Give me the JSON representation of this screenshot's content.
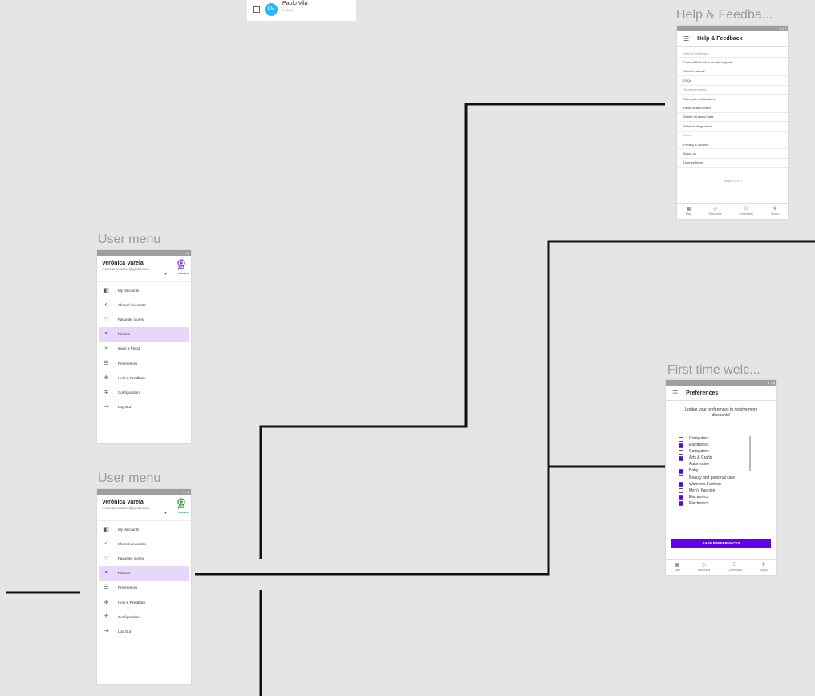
{
  "top_snippet": {
    "avatar_initials": "PM",
    "name": "Pablo Vila",
    "subtitle": "1 friend"
  },
  "frames": {
    "help_feedback_title": "Help & Feedba...",
    "user_menu_title_1": "User menu",
    "user_menu_title_2": "User menu",
    "preferences_title": "First time welc..."
  },
  "user_menu_1": {
    "status": "▾ ◂ ▮",
    "name": "Verónica Varela",
    "email": "v.varelamontalvo@gmail.com",
    "badge_label": "BRONZE",
    "badge_color": "#7b3fe4",
    "items": [
      {
        "label": "My discounts",
        "icon": "dashboard-icon"
      },
      {
        "label": "Shared discounts",
        "icon": "share-icon"
      },
      {
        "label": "Favorites stores",
        "icon": "heart-icon"
      },
      {
        "label": "Friends",
        "icon": "friends-icon"
      },
      {
        "label": "Invite a friend",
        "icon": "send-icon"
      },
      {
        "label": "Preferences",
        "icon": "list-icon"
      },
      {
        "label": "Help & Feedback",
        "icon": "help-icon"
      },
      {
        "label": "Configuration",
        "icon": "gear-icon"
      },
      {
        "label": "Log Out",
        "icon": "logout-icon"
      }
    ]
  },
  "user_menu_2": {
    "status": "▾ ◂ ▮",
    "name": "Verónica Varela",
    "email": "v.varelamontalvo@gmail.com",
    "badge_label": "BRONZE",
    "badge_color": "#2e9e3e",
    "items": [
      {
        "label": "My discounts",
        "icon": "dashboard-icon"
      },
      {
        "label": "Shared discounts",
        "icon": "share-icon"
      },
      {
        "label": "Favorites stores",
        "icon": "heart-icon"
      },
      {
        "label": "Friends",
        "icon": "friends-icon"
      },
      {
        "label": "Preferences",
        "icon": "list-icon"
      },
      {
        "label": "Help & Feedback",
        "icon": "help-icon"
      },
      {
        "label": "Configuration",
        "icon": "gear-icon"
      },
      {
        "label": "Log Out",
        "icon": "logout-icon"
      }
    ]
  },
  "help_feedback": {
    "status": "▾ ◂ ▮",
    "title": "Help & Feedback",
    "rows": [
      {
        "label": "Help & Feedback",
        "section": true
      },
      {
        "label": "Contact BizkaiaUn mobile support",
        "section": false
      },
      {
        "label": "Send feedback",
        "section": false
      },
      {
        "label": "FAQs",
        "section": false
      },
      {
        "label": "Troubleshooting",
        "section": true
      },
      {
        "label": "Test push notifications",
        "section": false
      },
      {
        "label": "Reset search index",
        "section": false
      },
      {
        "label": "Delete all saved data",
        "section": false
      },
      {
        "label": "Network diagnostics",
        "section": false
      },
      {
        "label": "About",
        "section": true
      },
      {
        "label": "Privacy & cookies",
        "section": false
      },
      {
        "label": "About us",
        "section": false
      },
      {
        "label": "License terms",
        "section": false
      }
    ],
    "version": "Version 1.0.0",
    "nav": [
      {
        "label": "Map",
        "icon": "map-icon"
      },
      {
        "label": "Discounts",
        "icon": "tag-icon"
      },
      {
        "label": "Community",
        "icon": "community-icon"
      },
      {
        "label": "Shops",
        "icon": "pin-icon"
      }
    ]
  },
  "preferences": {
    "status": "▾ ◂ ▮",
    "title": "Preferences",
    "prompt": "Update your preferences to receive more discounts!",
    "items": [
      {
        "label": "Computers",
        "checked": false
      },
      {
        "label": "Electronics",
        "checked": true
      },
      {
        "label": "Computers",
        "checked": false
      },
      {
        "label": "Arts & Crafts",
        "checked": true
      },
      {
        "label": "Automotive",
        "checked": false
      },
      {
        "label": "Baby",
        "checked": true
      },
      {
        "label": "Beauty and personal care",
        "checked": false
      },
      {
        "label": "Women's Fashion",
        "checked": true
      },
      {
        "label": "Men's Fashion",
        "checked": false
      },
      {
        "label": "Electronics",
        "checked": true
      },
      {
        "label": "Electronics",
        "checked": true
      }
    ],
    "button": "SAVE PREFERENCES",
    "accent": "#6200ea",
    "nav": [
      {
        "label": "Map",
        "icon": "map-icon"
      },
      {
        "label": "Discounts",
        "icon": "tag-icon"
      },
      {
        "label": "Community",
        "icon": "community-icon"
      },
      {
        "label": "Shops",
        "icon": "pin-icon"
      }
    ]
  }
}
